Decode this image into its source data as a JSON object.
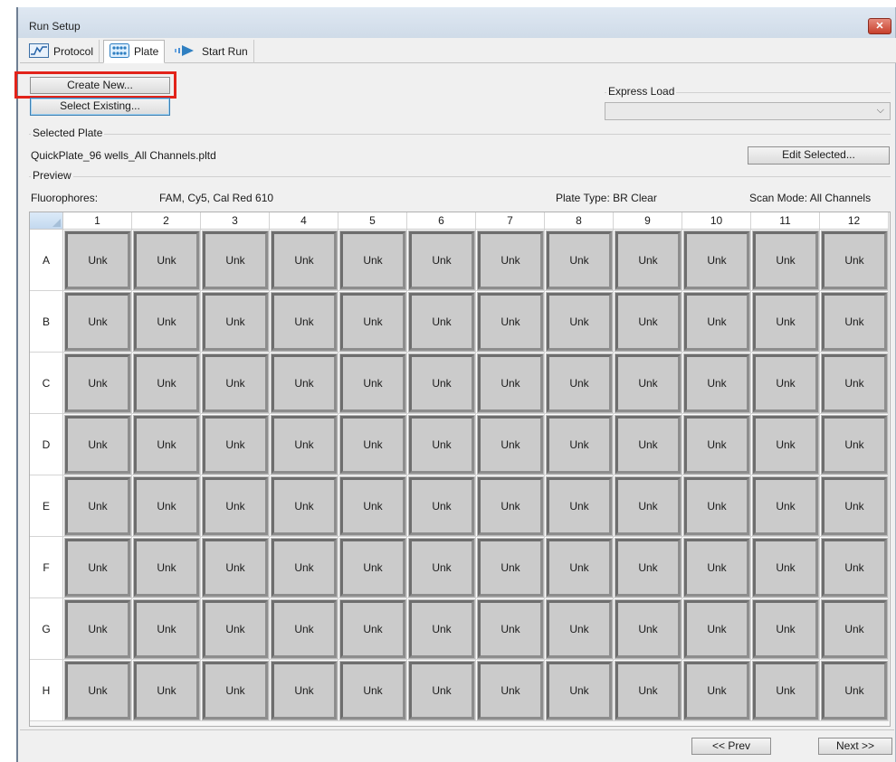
{
  "window": {
    "title": "Run Setup",
    "close_glyph": "✕"
  },
  "tabs": [
    {
      "label": "Protocol",
      "icon": "protocol-wave-icon"
    },
    {
      "label": "Plate",
      "icon": "plate-grid-icon"
    },
    {
      "label": "Start Run",
      "icon": "start-run-arrow-icon"
    }
  ],
  "buttons": {
    "create_new": "Create New...",
    "select_existing": "Select Existing...",
    "edit_selected": "Edit Selected...",
    "prev": "<< Prev",
    "next": "Next >>"
  },
  "express_load": {
    "label": "Express Load",
    "value": "",
    "arrow": "⌵"
  },
  "selected_plate": {
    "label": "Selected Plate",
    "file": "QuickPlate_96 wells_All Channels.pltd"
  },
  "preview": {
    "label": "Preview",
    "fluorophores_label": "Fluorophores:",
    "fluorophores_value": "FAM, Cy5, Cal Red 610",
    "plate_type": "Plate Type: BR Clear",
    "scan_mode": "Scan Mode: All Channels"
  },
  "plate": {
    "columns": [
      "1",
      "2",
      "3",
      "4",
      "5",
      "6",
      "7",
      "8",
      "9",
      "10",
      "11",
      "12"
    ],
    "rows": [
      "A",
      "B",
      "C",
      "D",
      "E",
      "F",
      "G",
      "H"
    ],
    "well_label": "Unk"
  },
  "colors": {
    "highlight": "#e2231a",
    "well_fill": "#cbcbcb",
    "accent": "#3c7fb1"
  }
}
